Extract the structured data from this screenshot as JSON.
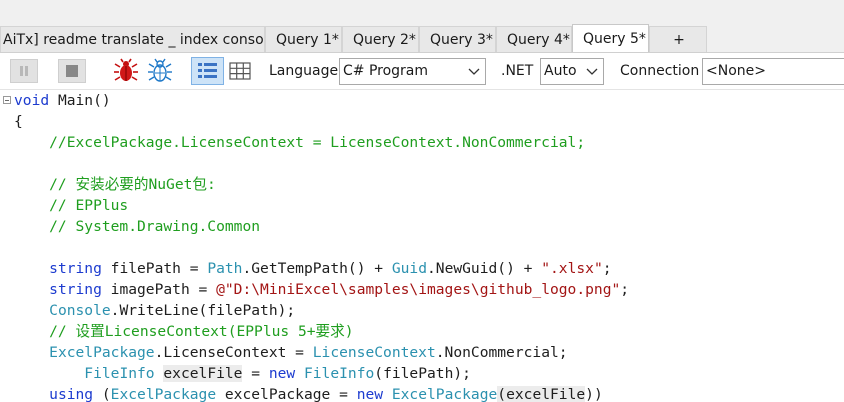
{
  "tabs": [
    {
      "label": "AiTx] readme translate _ index console",
      "active": false
    },
    {
      "label": "Query 1*",
      "active": false
    },
    {
      "label": "Query 2*",
      "active": false
    },
    {
      "label": "Query 3*",
      "active": false
    },
    {
      "label": "Query 4*",
      "active": false
    },
    {
      "label": "Query 5*",
      "active": true
    },
    {
      "label": "+",
      "active": false
    }
  ],
  "toolbar": {
    "language_label": "Language",
    "language_value": "C# Program",
    "net_label": ".NET",
    "net_value": "Auto",
    "connection_label": "Connection",
    "connection_value": "<None>",
    "icons": [
      "pause-icon",
      "stop-icon",
      "bug-red-icon",
      "bug-blue-icon",
      "rich-text-grid-icon",
      "data-grid-icon"
    ]
  },
  "code": {
    "line1_kw": "void",
    "line1_rest": " Main()",
    "line2": "{",
    "line3": "    //ExcelPackage.LicenseContext = LicenseContext.NonCommercial;",
    "line5": "    // 安装必要的NuGet包:",
    "line6": "    // EPPlus",
    "line7": "    // System.Drawing.Common",
    "line9_kw": "string",
    "line9_a": " filePath = ",
    "line9_ty1": "Path",
    "line9_b": ".GetTempPath() + ",
    "line9_ty2": "Guid",
    "line9_c": ".NewGuid() + ",
    "line9_str": "\".xlsx\"",
    "line9_d": ";",
    "line10_kw": "string",
    "line10_a": " imagePath = ",
    "line10_str": "@\"D:\\MiniExcel\\samples\\images\\github_logo.png\"",
    "line10_b": ";",
    "line11_ty": "Console",
    "line11_a": ".WriteLine(filePath);",
    "line12": "    // 设置LicenseContext(EPPlus 5+要求)",
    "line13_ty1": "ExcelPackage",
    "line13_a": ".LicenseContext = ",
    "line13_ty2": "LicenseContext",
    "line13_b": ".NonCommercial;",
    "line14_ty1": "FileInfo",
    "line14_hl1": "excelFile",
    "line14_a": " = ",
    "line14_kw": "new",
    "line14_sp": " ",
    "line14_ty2": "FileInfo",
    "line14_b": "(filePath);",
    "line15_kw1": "using",
    "line15_a": " (",
    "line15_ty1": "ExcelPackage",
    "line15_b": " excelPackage = ",
    "line15_kw2": "new",
    "line15_sp": " ",
    "line15_ty2": "ExcelPackage",
    "line15_hl": "(excelFile",
    "line15_c": "))"
  },
  "colors": {
    "keyword": "#1c3bcf",
    "type": "#2b91af",
    "comment": "#1f9e1f",
    "string": "#a31515"
  }
}
